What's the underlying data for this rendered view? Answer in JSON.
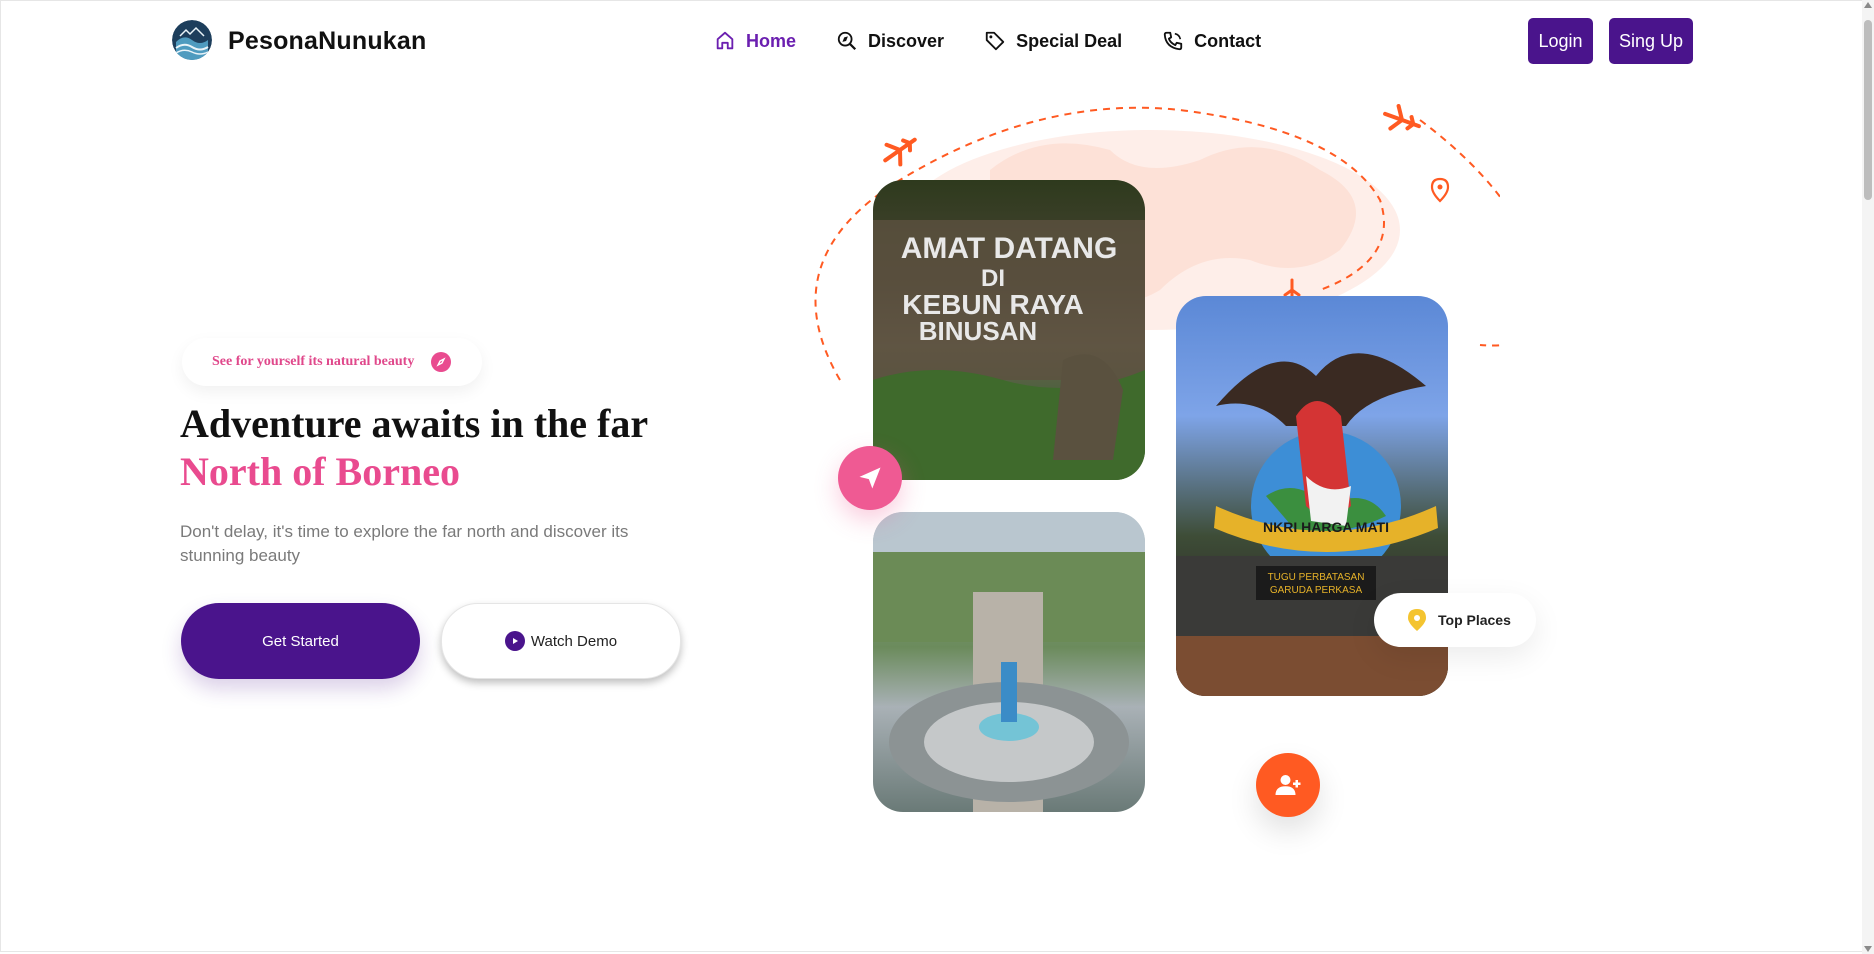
{
  "header": {
    "brand": "PesonaNunukan",
    "nav": [
      {
        "label": "Home",
        "icon": "home-icon",
        "active": true
      },
      {
        "label": "Discover",
        "icon": "discover-icon",
        "active": false
      },
      {
        "label": "Special Deal",
        "icon": "tag-icon",
        "active": false
      },
      {
        "label": "Contact",
        "icon": "phone-icon",
        "active": false
      }
    ],
    "login_label": "Login",
    "signup_label": "Sing Up"
  },
  "hero": {
    "tagline": "See for yourself its natural beauty",
    "title_line1": "Adventure awaits in the far",
    "title_line2": "North of Borneo",
    "description": "Don't delay, it's time to explore the far north and discover its stunning beauty",
    "get_started_label": "Get Started",
    "watch_demo_label": "Watch Demo"
  },
  "gallery": {
    "photo1_text": [
      "AMAT DATANG",
      "DI",
      "KEBUN RAYA",
      "BINUSAN"
    ],
    "photo3_text": [
      "NKRI HARGA MATI",
      "TUGU PERBATASAN",
      "GARUDA PERKASA"
    ],
    "top_places_label": "Top Places"
  },
  "colors": {
    "primary": "#4a148c",
    "accent_pink": "#e94b8f",
    "accent_orange": "#ff5a22",
    "active_nav": "#6b1fb0"
  }
}
